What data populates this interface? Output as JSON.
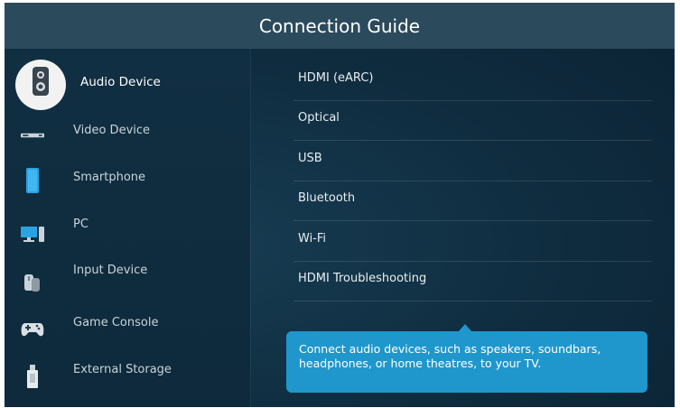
{
  "header": {
    "title": "Connection Guide"
  },
  "sidebar": {
    "items": [
      {
        "label": "Audio Device",
        "icon": "speaker-icon",
        "selected": true
      },
      {
        "label": "Video Device",
        "icon": "video-device-icon"
      },
      {
        "label": "Smartphone",
        "icon": "smartphone-icon"
      },
      {
        "label": "PC",
        "icon": "pc-icon"
      },
      {
        "label": "Input Device",
        "icon": "input-device-icon"
      },
      {
        "label": "Game Console",
        "icon": "gamepad-icon"
      },
      {
        "label": "External Storage",
        "icon": "usb-storage-icon"
      }
    ]
  },
  "options": {
    "items": [
      {
        "label": "HDMI (eARC)"
      },
      {
        "label": "Optical"
      },
      {
        "label": "USB"
      },
      {
        "label": "Bluetooth"
      },
      {
        "label": "Wi-Fi"
      },
      {
        "label": "HDMI Troubleshooting"
      }
    ]
  },
  "tooltip": {
    "text": "Connect audio devices, such as speakers, soundbars, headphones, or home theatres, to your TV."
  },
  "colors": {
    "accent": "#1f97cc",
    "header": "#2b4a5c",
    "background": "#0f2c3f"
  }
}
